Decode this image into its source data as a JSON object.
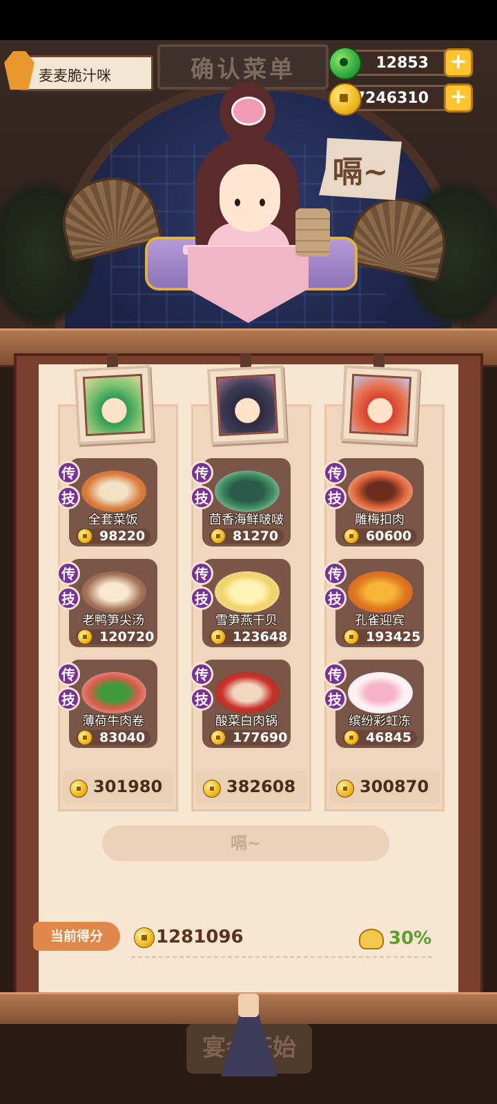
{
  "header": {
    "player_name": "麦麦脆汁咪",
    "sign_title": "确认菜单",
    "jade_amount": "12853",
    "coin_amount": "7246310",
    "speech_bubble": "嗝~"
  },
  "columns": [
    {
      "dishes": [
        {
          "name": "全套菜饭",
          "price": "98220"
        },
        {
          "name": "老鸭笋尖汤",
          "price": "120720"
        },
        {
          "name": "薄荷牛肉卷",
          "price": "83040"
        }
      ],
      "total": "301980"
    },
    {
      "dishes": [
        {
          "name": "茴香海鲜啵啵",
          "price": "81270"
        },
        {
          "name": "雪笋燕干贝",
          "price": "123648"
        },
        {
          "name": "酸菜白肉锅",
          "price": "177690"
        }
      ],
      "total": "382608"
    },
    {
      "dishes": [
        {
          "name": "雕梅扣肉",
          "price": "60600"
        },
        {
          "name": "孔雀迎宾",
          "price": "193425"
        },
        {
          "name": "缤纷彩虹冻",
          "price": "46845"
        }
      ],
      "total": "300870"
    }
  ],
  "badges": {
    "legend": "传",
    "skill": "技"
  },
  "action_button": "嗝~",
  "score": {
    "label": "当前得分",
    "value": "1281096",
    "bonus": "30%"
  },
  "start_button": "宴会开始",
  "colors": {
    "legend_badge": "#7a2f9a",
    "bonus_green": "#5aa02c",
    "coin_gold": "#f0b81c"
  }
}
